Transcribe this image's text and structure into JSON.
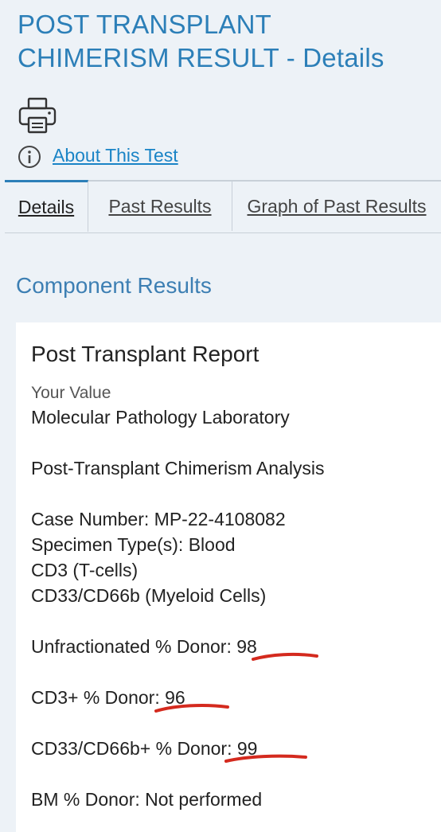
{
  "header": {
    "title_line1": "POST TRANSPLANT",
    "title_line2": "CHIMERISM RESULT - Details"
  },
  "toolbar": {
    "print_icon": "printer-icon",
    "info_icon": "info-icon",
    "about_label": "About This Test"
  },
  "tabs": [
    {
      "label": "Details",
      "active": true
    },
    {
      "label": "Past Results",
      "active": false
    },
    {
      "label": "Graph of Past Results",
      "active": false
    }
  ],
  "main": {
    "section_heading": "Component Results",
    "card": {
      "title": "Post Transplant Report",
      "value_label": "Your Value",
      "lines": [
        "Molecular Pathology Laboratory",
        "",
        "Post-Transplant Chimerism Analysis",
        "",
        "Case Number: MP-22-4108082",
        "Specimen Type(s): Blood",
        "CD3 (T-cells)",
        "CD33/CD66b (Myeloid Cells)",
        "",
        "Unfractionated % Donor: 98",
        "",
        "CD3+ % Donor: 96",
        "",
        "CD33/CD66b+ % Donor: 99",
        "",
        "BM % Donor: Not performed"
      ]
    }
  },
  "colors": {
    "accent": "#2c7fb8",
    "link": "#1a84c6",
    "annotation": "#d42a1e",
    "background": "#edf2f7"
  }
}
